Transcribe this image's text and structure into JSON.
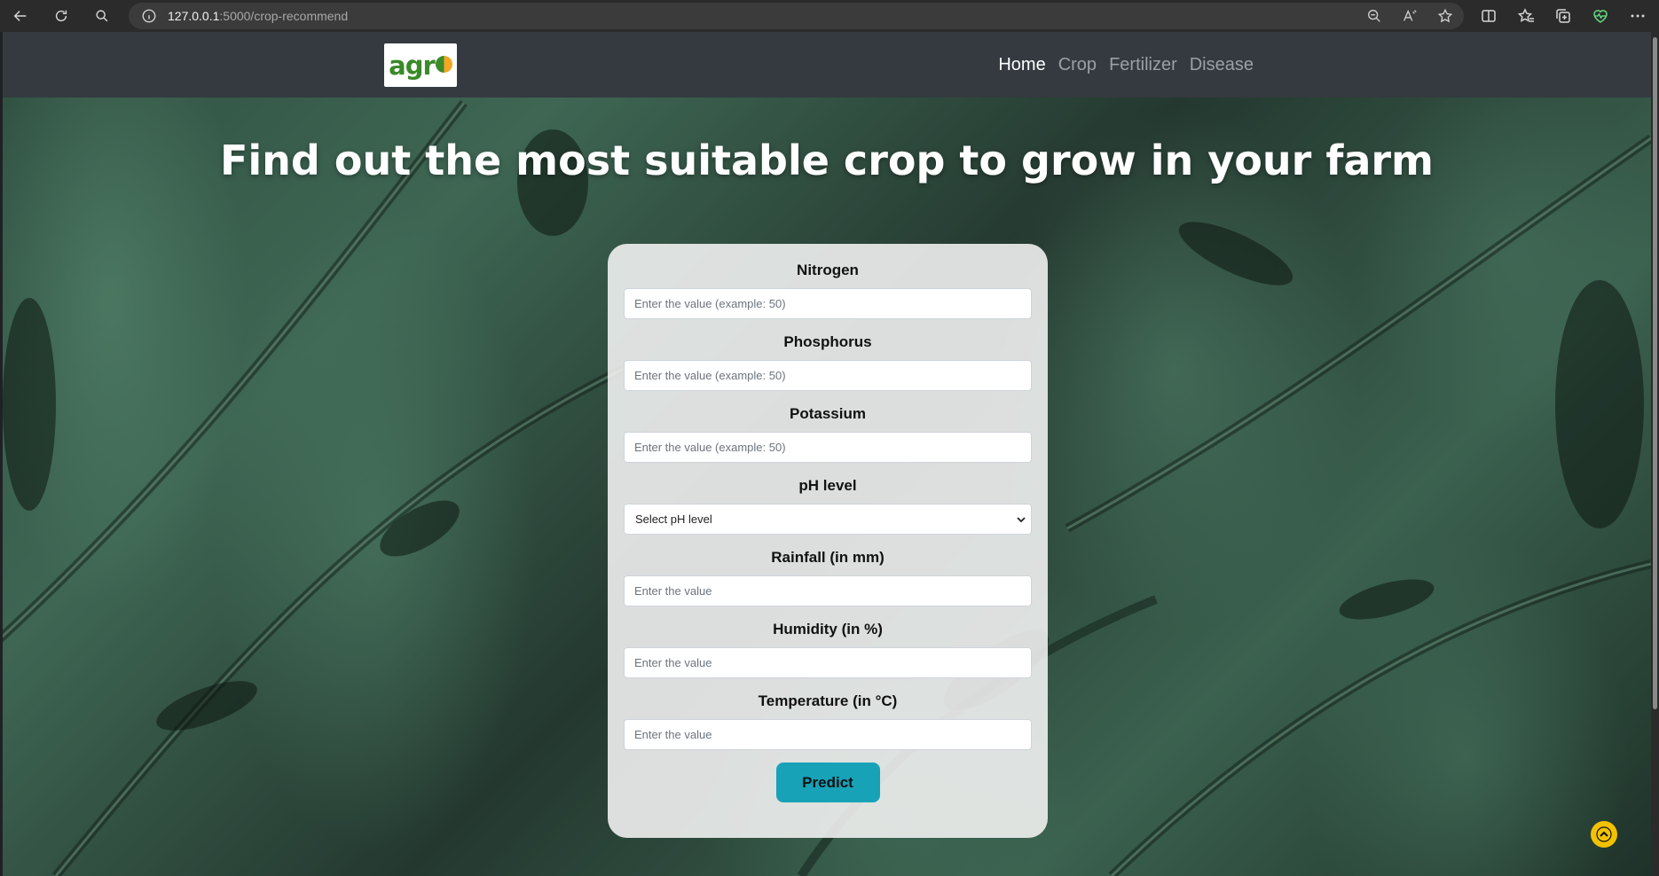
{
  "browser": {
    "url_host": "127.0.0.1",
    "url_rest": ":5000/crop-recommend",
    "icons": [
      "back-icon",
      "refresh-icon",
      "search-icon",
      "info-icon",
      "zoom-out-icon",
      "read-aloud-icon",
      "favorite-icon",
      "split-screen-icon",
      "favorites-icon",
      "collections-icon",
      "health-icon",
      "more-icon"
    ]
  },
  "navbar": {
    "logo_text": "agr",
    "links": [
      {
        "label": "Home",
        "active": true
      },
      {
        "label": "Crop",
        "active": false
      },
      {
        "label": "Fertilizer",
        "active": false
      },
      {
        "label": "Disease",
        "active": false
      }
    ]
  },
  "hero": {
    "title": "Find out the most suitable crop to grow in your farm"
  },
  "form": {
    "nitrogen": {
      "label": "Nitrogen",
      "placeholder": "Enter the value (example: 50)"
    },
    "phosphorus": {
      "label": "Phosphorus",
      "placeholder": "Enter the value (example: 50)"
    },
    "potassium": {
      "label": "Potassium",
      "placeholder": "Enter the value (example: 50)"
    },
    "ph": {
      "label": "pH level",
      "selected": "Select pH level"
    },
    "rainfall": {
      "label": "Rainfall (in mm)",
      "placeholder": "Enter the value"
    },
    "humidity": {
      "label": "Humidity (in %)",
      "placeholder": "Enter the value"
    },
    "temperature": {
      "label": "Temperature (in °C)",
      "placeholder": "Enter the value"
    },
    "submit_label": "Predict"
  },
  "colors": {
    "navbar_bg": "#343a40",
    "button_bg": "#17a2b8",
    "scroll_top_bg": "#f2c200"
  }
}
